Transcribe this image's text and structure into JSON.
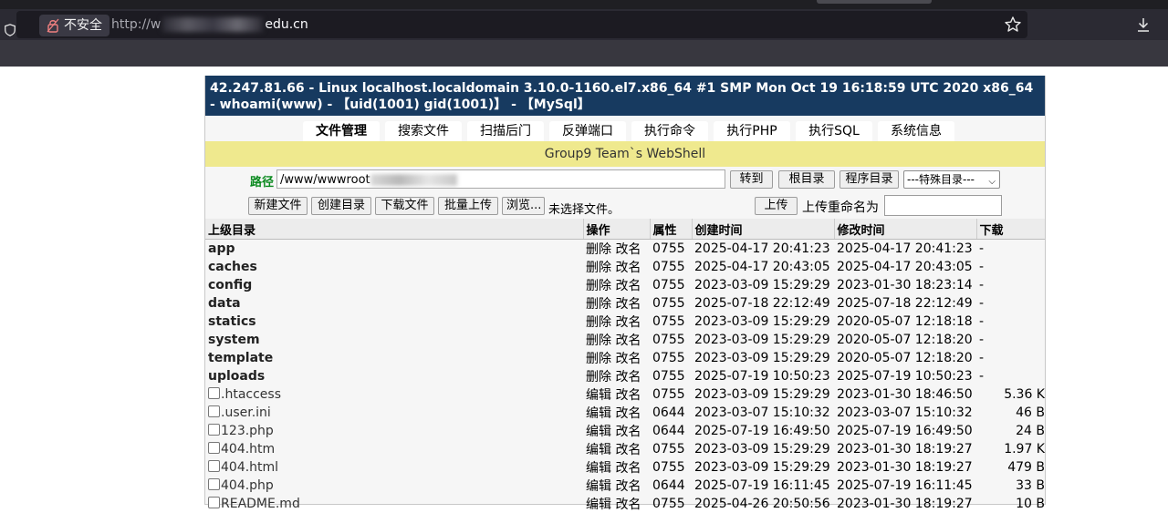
{
  "browser": {
    "security_label": "不安全",
    "url_prefix": "http://w",
    "url_suffix": "edu.cn"
  },
  "shell": {
    "title": "42.247.81.66 - Linux localhost.localdomain 3.10.0-1160.el7.x86_64 #1 SMP Mon Oct 19 16:18:59 UTC 2020 x86_64 - whoami(www) - 【uid(1001) gid(1001)】 - 【MySql】",
    "tabs": [
      "文件管理",
      "搜索文件",
      "扫描后门",
      "反弹端口",
      "执行命令",
      "执行PHP",
      "执行SQL",
      "系统信息"
    ],
    "banner": "Group9 Team`s WebShell",
    "path_label": "路径",
    "path_value": "/www/wwwroot",
    "goto_label": "转到",
    "root_label": "根目录",
    "program_label": "程序目录",
    "special_select": "---特殊目录---",
    "new_file": "新建文件",
    "create_dir": "创建目录",
    "download_file": "下载文件",
    "batch_upload": "批量上传",
    "browse": "浏览...",
    "no_file": "未选择文件。",
    "upload": "上传",
    "upload_rename": "上传重命名为",
    "columns": [
      "上级目录",
      "操作",
      "属性",
      "创建时间",
      "修改时间",
      "下载"
    ],
    "dirs": [
      {
        "name": "app",
        "ops": "删除 改名",
        "perm": "0755",
        "ctime": "2025-04-17 20:41:23",
        "mtime": "2025-04-17 20:41:23",
        "size": "-"
      },
      {
        "name": "caches",
        "ops": "删除 改名",
        "perm": "0755",
        "ctime": "2025-04-17 20:43:05",
        "mtime": "2025-04-17 20:43:05",
        "size": "-"
      },
      {
        "name": "config",
        "ops": "删除 改名",
        "perm": "0755",
        "ctime": "2023-03-09 15:29:29",
        "mtime": "2023-01-30 18:23:14",
        "size": "-"
      },
      {
        "name": "data",
        "ops": "删除 改名",
        "perm": "0755",
        "ctime": "2025-07-18 22:12:49",
        "mtime": "2025-07-18 22:12:49",
        "size": "-"
      },
      {
        "name": "statics",
        "ops": "删除 改名",
        "perm": "0755",
        "ctime": "2023-03-09 15:29:29",
        "mtime": "2020-05-07 12:18:18",
        "size": "-"
      },
      {
        "name": "system",
        "ops": "删除 改名",
        "perm": "0755",
        "ctime": "2023-03-09 15:29:29",
        "mtime": "2020-05-07 12:18:20",
        "size": "-"
      },
      {
        "name": "template",
        "ops": "删除 改名",
        "perm": "0755",
        "ctime": "2023-03-09 15:29:29",
        "mtime": "2020-05-07 12:18:20",
        "size": "-"
      },
      {
        "name": "uploads",
        "ops": "删除 改名",
        "perm": "0755",
        "ctime": "2025-07-19 10:50:23",
        "mtime": "2025-07-19 10:50:23",
        "size": "-"
      }
    ],
    "files": [
      {
        "name": ".htaccess",
        "ops": "编辑 改名",
        "perm": "0755",
        "ctime": "2023-03-09 15:29:29",
        "mtime": "2023-01-30 18:46:50",
        "size": "5.36 K"
      },
      {
        "name": ".user.ini",
        "ops": "编辑 改名",
        "perm": "0644",
        "ctime": "2023-03-07 15:10:32",
        "mtime": "2023-03-07 15:10:32",
        "size": "46 B"
      },
      {
        "name": "123.php",
        "ops": "编辑 改名",
        "perm": "0644",
        "ctime": "2025-07-19 16:49:50",
        "mtime": "2025-07-19 16:49:50",
        "size": "24 B"
      },
      {
        "name": "404.htm",
        "ops": "编辑 改名",
        "perm": "0755",
        "ctime": "2023-03-09 15:29:29",
        "mtime": "2023-01-30 18:19:27",
        "size": "1.97 K"
      },
      {
        "name": "404.html",
        "ops": "编辑 改名",
        "perm": "0755",
        "ctime": "2023-03-09 15:29:29",
        "mtime": "2023-01-30 18:19:27",
        "size": "479 B"
      },
      {
        "name": "404.php",
        "ops": "编辑 改名",
        "perm": "0644",
        "ctime": "2025-07-19 16:11:45",
        "mtime": "2025-07-19 16:11:45",
        "size": "33 B"
      },
      {
        "name": "README.md",
        "ops": "编辑 改名",
        "perm": "0755",
        "ctime": "2025-04-26 20:50:56",
        "mtime": "2023-01-30 18:19:27",
        "size": "10 B"
      }
    ]
  }
}
